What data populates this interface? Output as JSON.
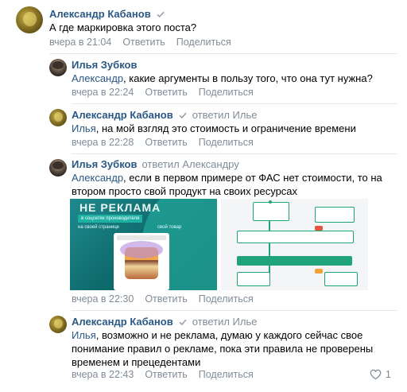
{
  "comments": [
    {
      "author": "Александр Кабанов",
      "verified": true,
      "reply_to": "",
      "mention": "",
      "text": "А где маркировка этого поста?",
      "time": "вчера в 21:04",
      "reply_label": "Ответить",
      "share_label": "Поделиться"
    },
    {
      "author": "Илья Зубков",
      "verified": false,
      "reply_to": "",
      "mention": "Александр",
      "text": ", какие аргументы в пользу того, что она тут нужна?",
      "time": "вчера в 22:24",
      "reply_label": "Ответить",
      "share_label": "Поделиться"
    },
    {
      "author": "Александр Кабанов",
      "verified": true,
      "reply_to": "ответил Илье",
      "mention": "Илья",
      "text": ", на мой взгляд это стоимость и ограничение времени",
      "time": "вчера в 22:28",
      "reply_label": "Ответить",
      "share_label": "Поделиться"
    },
    {
      "author": "Илья Зубков",
      "verified": false,
      "reply_to": "ответил Александру",
      "mention": "Александр",
      "text": ", если в первом примере от ФАС нет стоимости, то на втором просто свой продукт на своих ресурсах",
      "time": "вчера в 22:30",
      "reply_label": "Ответить",
      "share_label": "Поделиться",
      "attachment_1": {
        "heading": "НЕ РЕКЛАМА",
        "ribbon": "в соцсетях производителя",
        "left_label": "на своей странице",
        "right_label": "свой товар"
      }
    },
    {
      "author": "Александр Кабанов",
      "verified": true,
      "reply_to": "ответил Илье",
      "mention": "Илья",
      "text": ", возможно и не реклама, думаю у каждого сейчас свое понимание правил о рекламе, пока эти правила не проверены временем и прецедентами",
      "time": "вчера в 22:43",
      "reply_label": "Ответить",
      "share_label": "Поделиться",
      "likes": "1"
    }
  ],
  "colors": {
    "link": "#2a5885",
    "meta": "#818c99",
    "divider": "#e7e8ec"
  }
}
